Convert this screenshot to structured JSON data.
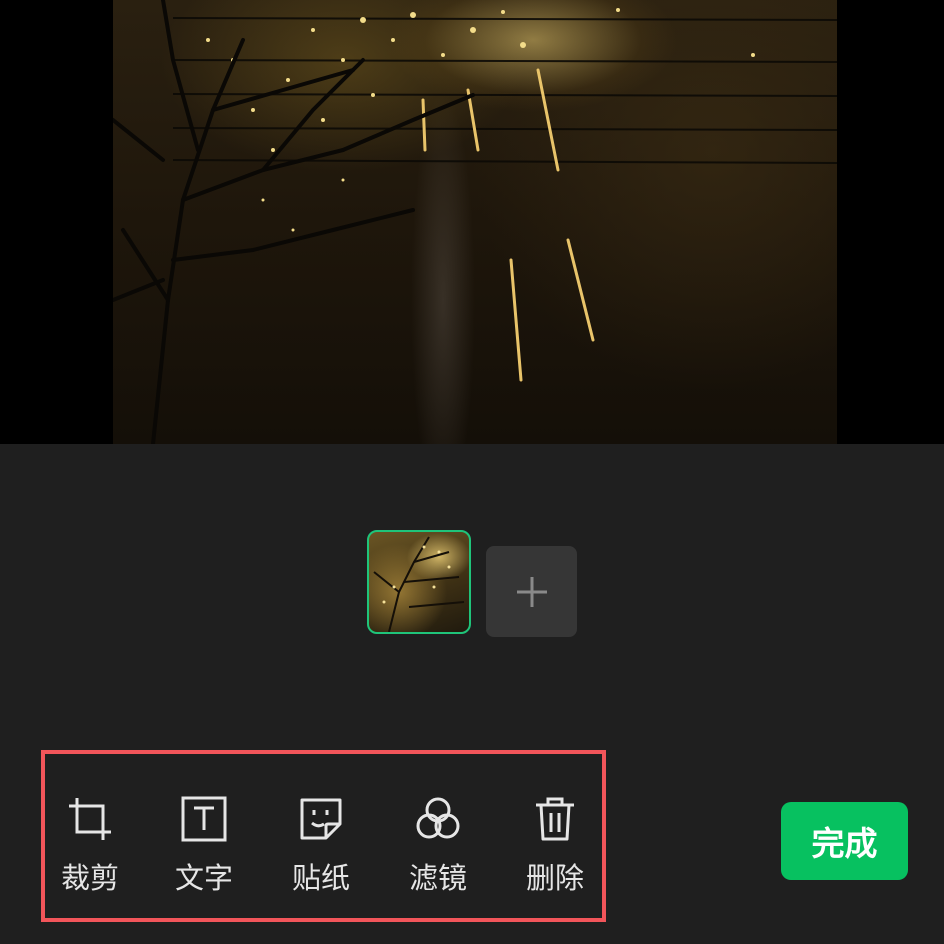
{
  "preview": {
    "image": "photo of fireworks over bare trees at night"
  },
  "filmstrip": {
    "selected_color": "#1fc47a",
    "add_icon": "plus-icon"
  },
  "toolbar": {
    "items": [
      {
        "label": "裁剪",
        "icon": "crop-icon"
      },
      {
        "label": "文字",
        "icon": "text-icon"
      },
      {
        "label": "贴纸",
        "icon": "sticker-icon"
      },
      {
        "label": "滤镜",
        "icon": "filter-icon"
      },
      {
        "label": "删除",
        "icon": "trash-icon"
      }
    ],
    "highlight_color": "#f2555a"
  },
  "done_button": {
    "label": "完成",
    "color": "#07c160"
  }
}
